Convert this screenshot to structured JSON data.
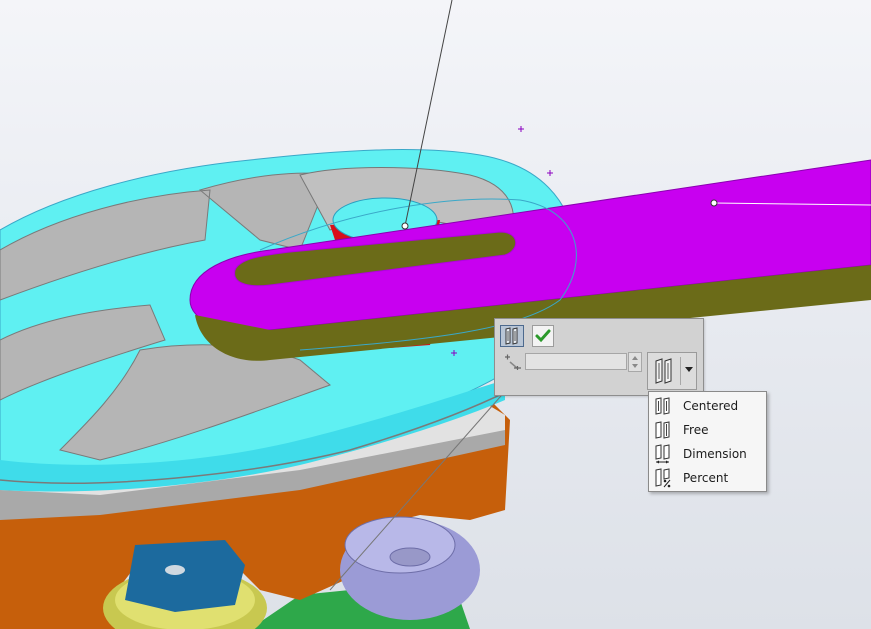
{
  "mate_toolbar": {
    "mode_toggle_icon": "slot-mate-icon",
    "accept_icon": "checkmark-icon",
    "distance_icon": "distance-icon",
    "distance_value": "",
    "spinner_icon": "spinner-icon",
    "mode_dropdown_icon": "slot-mate-centered-icon",
    "dropdown_arrow_icon": "chevron-down-icon"
  },
  "mode_menu": {
    "items": [
      {
        "label": "Centered",
        "icon": "slot-centered-icon"
      },
      {
        "label": "Free",
        "icon": "slot-free-icon"
      },
      {
        "label": "Dimension",
        "icon": "slot-dimension-icon"
      },
      {
        "label": "Percent",
        "icon": "slot-percent-icon"
      }
    ]
  },
  "colors": {
    "selection_cyan": "#5ff0f2",
    "slot_arm_magenta": "#c800f0",
    "slot_arm_olive": "#6b6b18",
    "pin_red": "#d8101a",
    "base_orange": "#c8620a",
    "hub_gray": "#b0b0b0",
    "lavender_part": "#9b9bd6",
    "teal_part": "#1f8b96",
    "blue_part": "#1c6a9e",
    "yellow_part": "#c8c850",
    "green_part": "#2ea84a"
  }
}
